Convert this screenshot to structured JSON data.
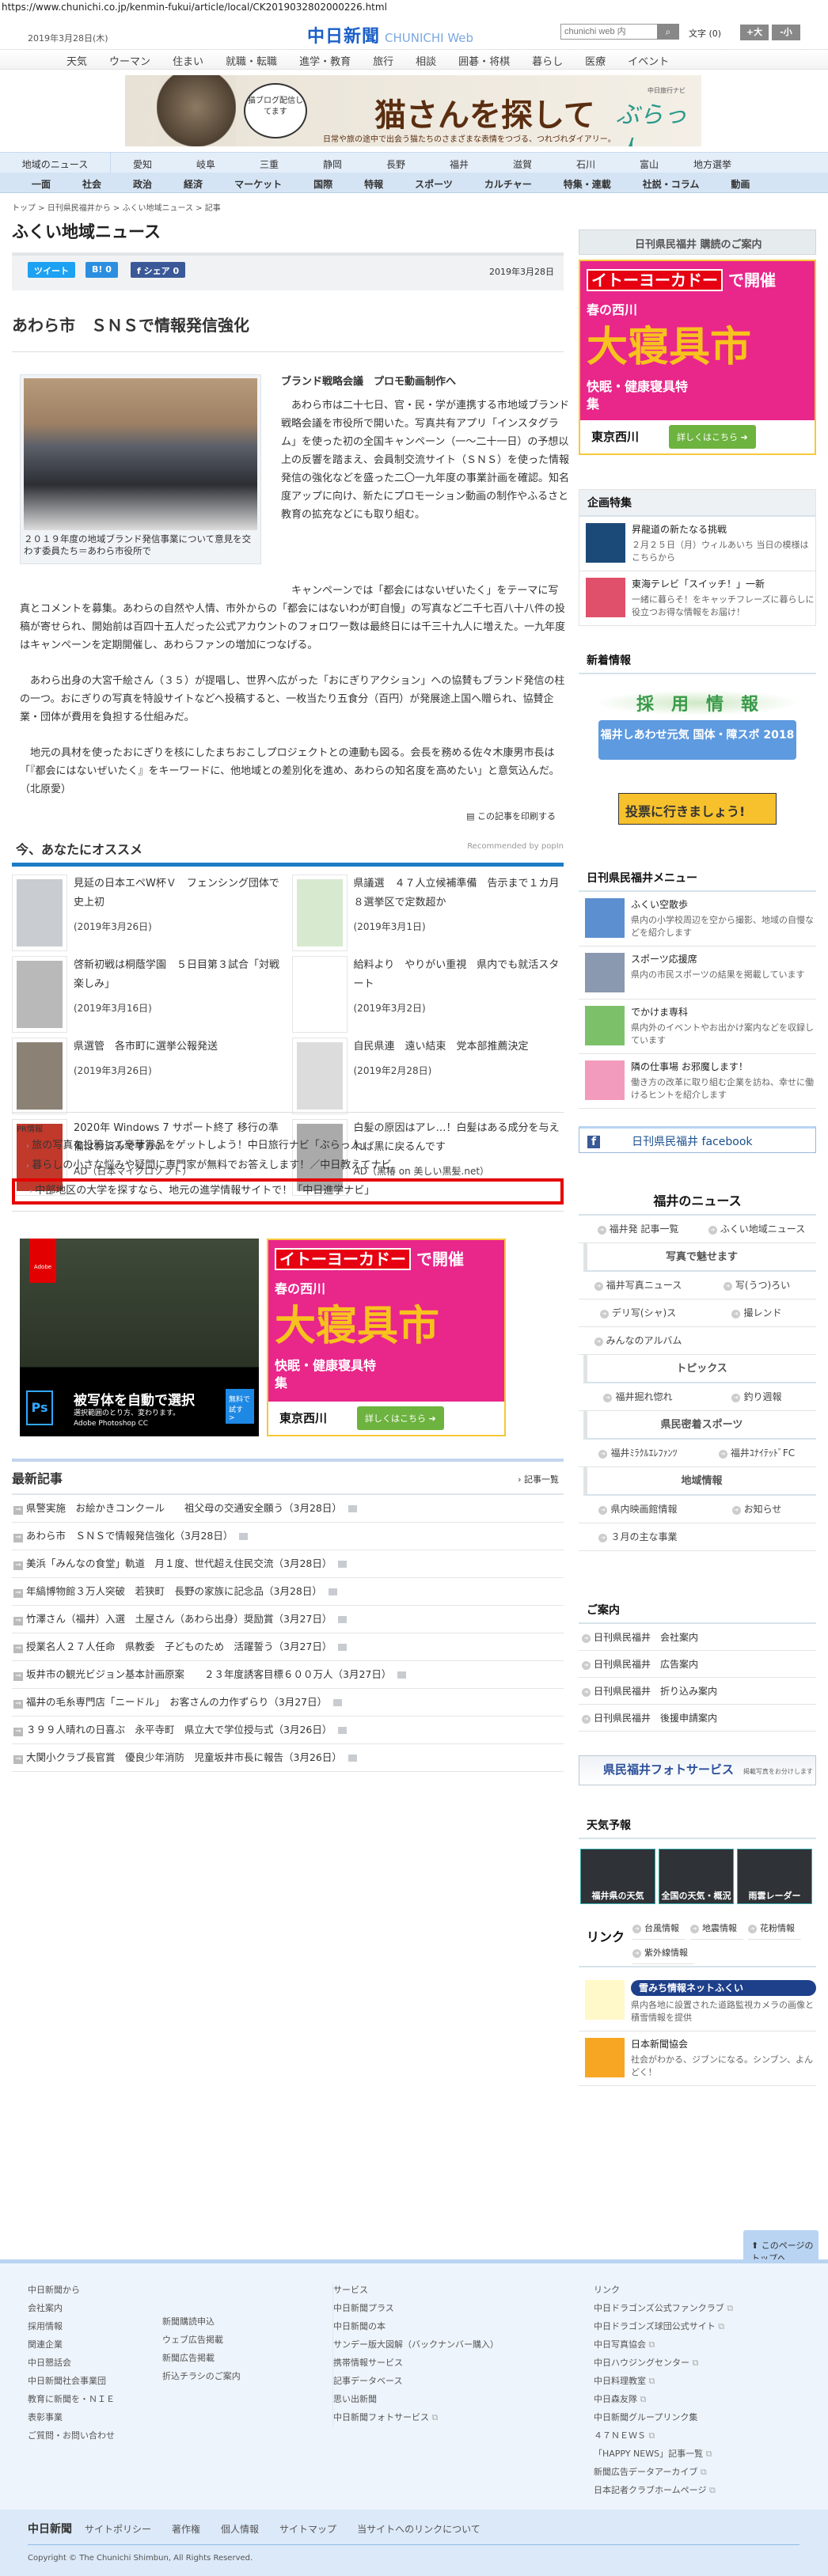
{
  "url": "https://www.chunichi.co.jp/kenmin-fukui/article/local/CK2019032802000226.html",
  "header": {
    "date": "2019年3月28日(木)",
    "logo": "中日新聞",
    "logo_sub": "CHUNICHI Web",
    "search_placeholder": "chunichi web 内",
    "font_label": "文字 (0)",
    "font_up": "+大",
    "font_down": "-小"
  },
  "top_nav": [
    "天気",
    "ウーマン",
    "住まい",
    "就職・転職",
    "進学・教育",
    "旅行",
    "相談",
    "囲碁・将棋",
    "暮らし",
    "医療",
    "イベント"
  ],
  "banner": {
    "bubble": "猫ブログ配信してます",
    "title": "猫さんを探して",
    "sub": "日常や旅の途中で出会う猫たちのさまざまな表情をつづる、つれづれダイアリー。",
    "brand": "ぶらっ人",
    "brand_tag": "中日旅行ナビ"
  },
  "region_nav": {
    "lead": "地域のニュース",
    "items": [
      "愛知",
      "岐阜",
      "三重",
      "静岡",
      "長野",
      "福井",
      "滋賀",
      "石川",
      "富山",
      "地方選挙"
    ]
  },
  "category_nav": [
    "一面",
    "社会",
    "政治",
    "経済",
    "マーケット",
    "国際",
    "特報",
    "スポーツ",
    "カルチャー",
    "特集・連載",
    "社説・コラム",
    "動画"
  ],
  "breadcrumb": "トップ > 日刊県民福井から > ふくい地域ニュース > 記事",
  "page_title": "ふくい地域ニュース",
  "share": {
    "tweet": "ツイート",
    "hatena": "B! 0",
    "facebook": "f シェア 0",
    "date": "2019年3月28日"
  },
  "article": {
    "title": "あわら市　ＳＮＳで情報発信強化",
    "subtitle": "ブランド戦略会議　プロモ動画制作へ",
    "caption": "２０１９年度の地域ブランド発信事業について意見を交わす委員たち＝あわら市役所で",
    "lede": "　あわら市は二十七日、官・民・学が連携する市地域ブランド戦略会議を市役所で開いた。写真共有アプリ「インスタグラム」を使った初の全国キャンペーン（一～二十一日）の予想以上の反響を踏まえ、会員制交流サイト（ＳＮＳ）を使った情報発信の強化などを盛った二〇一九年度の事業計画を確認。知名度アップに向け、新たにプロモーション動画の制作やふるさと教育の拡充などにも取り組む。",
    "paragraphs": [
      "　キャンペーンでは「都会にはないぜいたく」をテーマに写真とコメントを募集。あわらの自然や人情、市外からの「都会にはないわが町自慢」の写真など二千七百八十八件の投稿が寄せられ、開始前は百四十五人だった公式アカウントのフォロワー数は最終日には千三十九人に増えた。一九年度はキャンペーンを定期開催し、あわらファンの増加につなげる。",
      "　あわら出身の大宮千絵さん（３５）が提唱し、世界へ広がった「おにぎりアクション」への協賛もブランド発信の柱の一つ。おにぎりの写真を特設サイトなどへ投稿すると、一枚当たり五食分（百円）が発展途上国へ贈られ、協賛企業・団体が費用を負担する仕組みだ。",
      "　地元の具材を使ったおにぎりを核にしたまちおこしプロジェクトとの連動も図る。会長を務める佐々木康男市長は「『都会にはないぜいたく』をキーワードに、他地域との差別化を進め、あわらの知名度を高めたい」と意気込んだ。　（北原愛）"
    ],
    "print": "この記事を印刷する"
  },
  "recommend": {
    "title": "今、あなたにオススメ",
    "by": "Recommended by popIn",
    "items": [
      {
        "title": "見延の日本エペW杯Ｖ　フェンシング団体で史上初",
        "date": "(2019年3月26日)"
      },
      {
        "title": "県議選　４７人立候補準備　告示まで１カ月　８選挙区で定数超か",
        "date": "(2019年3月1日)"
      },
      {
        "title": "啓新初戦は桐蔭学園　５日目第３試合「対戦楽しみ」",
        "date": "(2019年3月16日)"
      },
      {
        "title": "給料より　やりがい重視　県内でも就活スタート",
        "date": "(2019年3月2日)"
      },
      {
        "title": "県選管　各市町に選挙公報発送",
        "date": "(2019年3月26日)"
      },
      {
        "title": "自民県連　遠い結束　党本部推薦決定",
        "date": "(2019年2月28日)"
      },
      {
        "title": "2020年 Windows 7 サポート終了 移行の準備はお済みですか？",
        "date": "AD（日本マイクロソフト）"
      },
      {
        "title": "白髪の原因はアレ…！白髪はある成分を与えれば黒に戻るんです",
        "date": "AD（黒椿 on 美しい黒髪.net）"
      }
    ]
  },
  "pr": {
    "label": "PR情報",
    "items": [
      "旅の写真を投稿して豪華賞品をゲットしよう！中日旅行ナビ「ぶらっ人」",
      "暮らしの小さな悩みや疑問に専門家が無料でお答えします！／中日教えてナビ",
      "中部地区の大学を探すなら、地元の進学情報サイトで！「中日進学ナビ」"
    ]
  },
  "ads": {
    "adobe": {
      "logo": "Adobe",
      "title": "被写体を自動で選択",
      "sub": "選択範囲のとり方、変わります。",
      "product": "Adobe Photoshop CC",
      "cta": "無料で試す >"
    },
    "yokado": {
      "head": "イトーヨーカドー",
      "head2": "で開催",
      "s1": "春の西川",
      "big": "大寝具市",
      "s2": "快眠・健康寝具特集",
      "brand": "東京西川",
      "cta": "詳しくはこちら ➜"
    }
  },
  "latest": {
    "title": "最新記事",
    "more": "記事一覧",
    "items": [
      "県警実施　お絵かきコンクール　　祖父母の交通安全願う（3月28日）",
      "あわら市　ＳＮＳで情報発信強化（3月28日）",
      "美浜「みんなの食堂」軌道　月１度、世代超え住民交流（3月28日）",
      "年縞博物館３万人突破　若狭町　長野の家族に記念品（3月28日）",
      "竹澤さん（福井）入選　土屋さん（あわら出身）奨励賞（3月27日）",
      "授業名人２７人任命　県教委　子どものため　活躍誓う（3月27日）",
      "坂井市の観光ビジョン基本計画原案　　２３年度誘客目標６００万人（3月27日）",
      "福井の毛糸専門店「ニードル」　お客さんの力作ずらり（3月27日）",
      "３９９人晴れの日喜ぶ　永平寺町　県立大で学位授与式（3月26日）",
      "大関小クラブ長官賞　優良少年消防　児童坂井市長に報告（3月26日）"
    ]
  },
  "sidebar": {
    "subscribe": "日刊県民福井 購読のご案内",
    "kikaku": {
      "title": "企画特集",
      "items": [
        {
          "title": "昇龍道の新たなる挑戦",
          "desc": "２月２５日（月）ウィルあいち 当日の模様はこちらから"
        },
        {
          "title": "東海テレビ「スイッチ！」一新",
          "desc": "一緒に暮らそ！をキャッチフレーズに暮らしに役立つお得な情報をお届け！"
        }
      ]
    },
    "shinchaku": {
      "title": "新着情報",
      "banner1": "採　用　情　報",
      "banner2": "福井しあわせ元気 国体・障スポ 2018",
      "vote": "投票に行きましょう!"
    },
    "menu": {
      "title": "日刊県民福井メニュー",
      "items": [
        {
          "title": "ふくい空散歩",
          "desc": "県内の小学校周辺を空から撮影、地域の自慢などを紹介します"
        },
        {
          "title": "スポーツ応援席",
          "desc": "県内の市民スポーツの結果を掲載しています"
        },
        {
          "title": "でかけま専科",
          "desc": "県内外のイベントやお出かけ案内などを収録しています"
        },
        {
          "title": "隣の仕事場 お邪魔します！",
          "desc": "働き方の改革に取り組む企業を訪ね、幸せに働けるヒントを紹介します"
        }
      ],
      "facebook": "日刊県民福井 facebook"
    },
    "fukui_news": {
      "title": "福井のニュース",
      "top": [
        "福井発 記事一覧",
        "ふくい地域ニュース"
      ],
      "sections": [
        {
          "title": "写真で魅せます",
          "links": [
            "福井写真ニュース",
            "写(うつ)ろい",
            "デリ写(シャ)ス",
            "撮レンド",
            "みんなのアルバム"
          ]
        },
        {
          "title": "トピックス",
          "links": [
            "福井掘れ惚れ",
            "釣り週報"
          ]
        },
        {
          "title": "県民密着スポーツ",
          "links": [
            "福井ﾐﾗｸﾙｴﾚﾌｧﾝﾂ",
            "福井ﾕﾅｲﾃｯﾄﾞFC"
          ]
        },
        {
          "title": "地域情報",
          "links": [
            "県内映画館情報",
            "お知らせ",
            "３月の主な事業"
          ]
        }
      ]
    },
    "annai": {
      "title": "ご案内",
      "items": [
        "日刊県民福井　会社案内",
        "日刊県民福井　広告案内",
        "日刊県民福井　折り込み案内",
        "日刊県民福井　後援申請案内"
      ],
      "photo": "県民福井フォトサービス",
      "photo_sub": "掲載写真をお分けします"
    },
    "weather": {
      "title": "天気予報",
      "items": [
        "福井県の天気",
        "全国の天気・概況",
        "雨雲レーダー"
      ]
    },
    "links": {
      "title": "リンク",
      "items": [
        "台風情報",
        "地震情報",
        "花粉情報",
        "紫外線情報"
      ],
      "entries": [
        {
          "title": "雪みち情報ネットふくい",
          "desc": "県内各地に設置された道路監視カメラの画像と積雪情報を提供"
        },
        {
          "title": "日本新聞協会",
          "desc": "社会がわかる、ジブンになる。シンブン、よんどく！"
        }
      ]
    }
  },
  "footer": {
    "to_top": "このページのトップへ",
    "col1": {
      "title": "中日新聞から",
      "a": [
        "会社案内",
        "採用情報",
        "関連企業",
        "中日懇話会",
        "中日新聞社会事業団",
        "教育に新聞を・ＮＩＥ",
        "表彰事業",
        "ご質問・お問い合わせ"
      ],
      "b": [
        "新聞購読申込",
        "ウェブ広告掲載",
        "新聞広告掲載",
        "折込チラシのご案内"
      ]
    },
    "col2": {
      "title": "サービス",
      "items": [
        "中日新聞プラス",
        "中日新聞の本",
        "サンデー版大図解（バックナンバー購入）",
        "携帯情報サービス",
        "記事データベース",
        "思い出新聞",
        "中日新聞フォトサービス"
      ]
    },
    "col3": {
      "title": "リンク",
      "items": [
        "中日ドラゴンズ公式ファンクラブ",
        "中日ドラゴンズ球団公式サイト",
        "中日写真協会",
        "中日ハウジングセンター",
        "中日料理教室",
        "中日森友隊",
        "中日新聞グループリンク集",
        "４７ＮＥＷＳ",
        "「HAPPY NEWS」記事一覧",
        "新聞広告データアーカイブ",
        "日本記者クラブホームページ"
      ]
    },
    "bar": {
      "logo": "中日新聞",
      "links": [
        "サイトポリシー",
        "著作権",
        "個人情報",
        "サイトマップ",
        "当サイトへのリンクについて"
      ]
    },
    "copyright": "Copyright © The Chunichi Shimbun, All Rights Reserved."
  },
  "colors": {
    "accent": "#1e7cc7",
    "highlight": "#e60000",
    "nav_bg": "#e4eef9",
    "footer_bg": "#eef4fb"
  }
}
